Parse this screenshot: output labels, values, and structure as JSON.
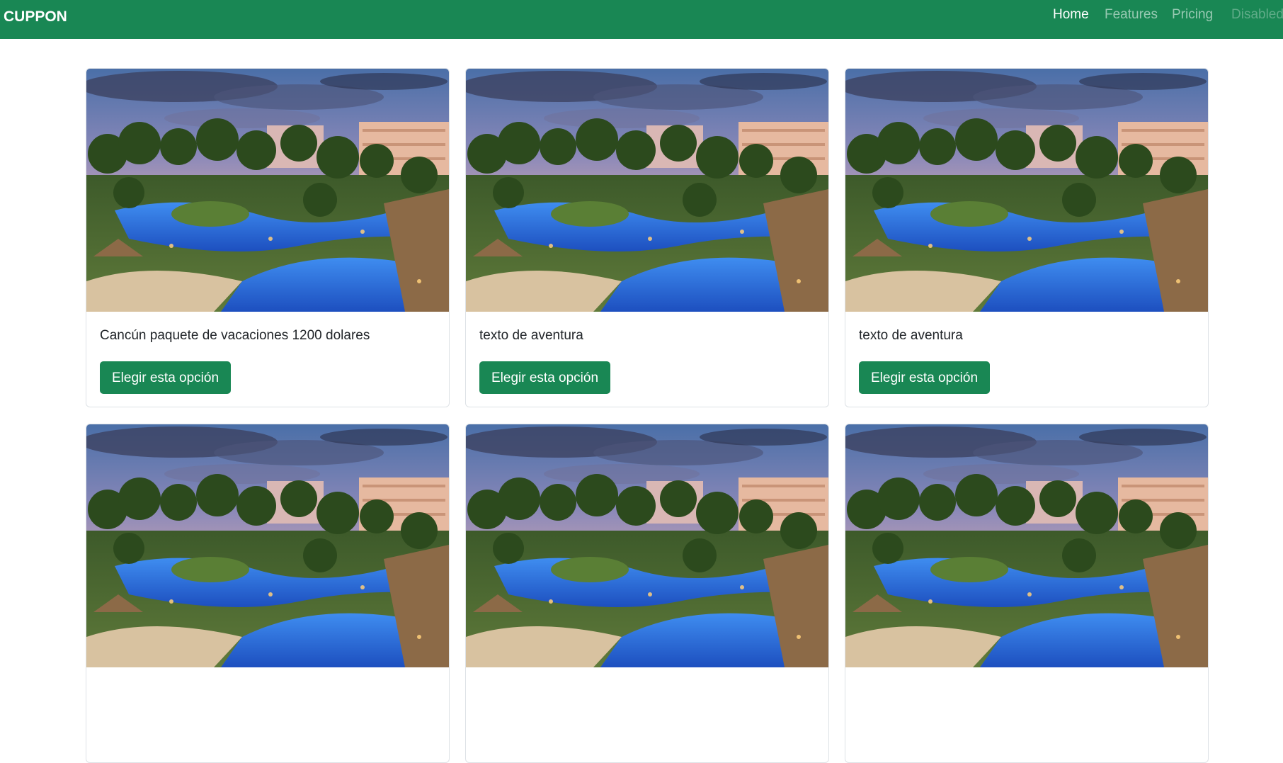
{
  "navbar": {
    "brand": "CUPPON",
    "links": [
      {
        "label": "Home",
        "state": "active"
      },
      {
        "label": "Features",
        "state": "normal"
      },
      {
        "label": "Pricing",
        "state": "normal"
      },
      {
        "label": "Disabled",
        "state": "disabled"
      }
    ]
  },
  "cards": [
    {
      "image": "resort-pool-photo",
      "text": "Cancún paquete de vacaciones 1200 dolares",
      "button_label": "Elegir esta opción"
    },
    {
      "image": "resort-pool-photo",
      "text": "texto de aventura",
      "button_label": "Elegir esta opción"
    },
    {
      "image": "resort-pool-photo",
      "text": "texto de aventura",
      "button_label": "Elegir esta opción"
    },
    {
      "image": "resort-pool-photo",
      "text": "",
      "button_label": ""
    },
    {
      "image": "resort-pool-photo",
      "text": "",
      "button_label": ""
    },
    {
      "image": "resort-pool-photo",
      "text": "",
      "button_label": ""
    }
  ],
  "colors": {
    "primary": "#198754",
    "border": "#dee2e6",
    "text": "#212529"
  }
}
